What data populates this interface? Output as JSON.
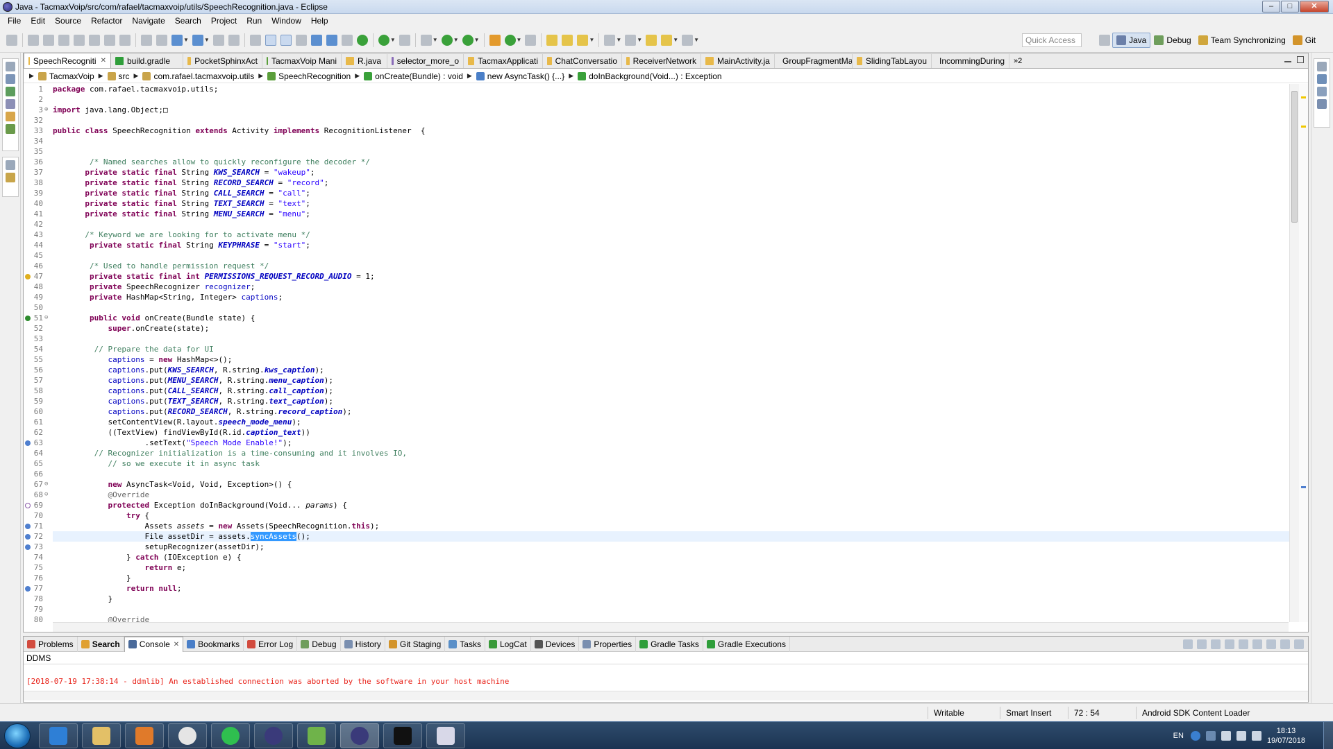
{
  "window": {
    "title": "Java - TacmaxVoip/src/com/rafael/tacmaxvoip/utils/SpeechRecognition.java - Eclipse"
  },
  "menu": [
    "File",
    "Edit",
    "Source",
    "Refactor",
    "Navigate",
    "Search",
    "Project",
    "Run",
    "Window",
    "Help"
  ],
  "toolbar": {
    "quick_access_placeholder": "Quick Access",
    "perspectives": [
      "Java",
      "Debug",
      "Team Synchronizing",
      "Git"
    ]
  },
  "editor_tabs": [
    {
      "label": "SpeechRecogniti",
      "active": true,
      "icon": "java-file-icon"
    },
    {
      "label": "build.gradle",
      "icon": "gradle-icon"
    },
    {
      "label": "PocketSphinxAct",
      "icon": "java-file-icon"
    },
    {
      "label": "TacmaxVoip Mani",
      "icon": "manifest-icon"
    },
    {
      "label": "R.java",
      "icon": "java-file-icon"
    },
    {
      "label": "selector_more_o",
      "icon": "xml-file-icon"
    },
    {
      "label": "TacmaxApplicati",
      "icon": "java-file-icon"
    },
    {
      "label": "ChatConversatio",
      "icon": "java-file-icon"
    },
    {
      "label": "ReceiverNetwork",
      "icon": "java-file-icon"
    },
    {
      "label": "MainActivity.ja",
      "icon": "java-file-icon"
    },
    {
      "label": "GroupFragmentMa",
      "icon": "java-file-icon"
    },
    {
      "label": "SlidingTabLayou",
      "icon": "java-file-icon"
    },
    {
      "label": "IncommingDuring",
      "icon": "java-file-icon"
    }
  ],
  "tab_overflow": "»2",
  "breadcrumb": [
    "TacmaxVoip",
    "src",
    "com.rafael.tacmaxvoip.utils",
    "SpeechRecognition",
    "onCreate(Bundle) : void",
    "new AsyncTask() {...}",
    "doInBackground(Void...) : Exception"
  ],
  "code_lines": [
    {
      "n": "1",
      "html": "<span class=\"kw\">package</span> com.rafael.tacmaxvoip.utils;"
    },
    {
      "n": "2",
      "html": ""
    },
    {
      "n": "3",
      "html": "<span class=\"kw\">import</span> java.lang.Object;&#9633;",
      "fold": "+"
    },
    {
      "n": "32",
      "html": ""
    },
    {
      "n": "33",
      "html": "<span class=\"kw\">public class</span> SpeechRecognition <span class=\"kw\">extends</span> Activity <span class=\"kw\">implements</span> RecognitionListener  {"
    },
    {
      "n": "34",
      "html": ""
    },
    {
      "n": "35",
      "html": ""
    },
    {
      "n": "36",
      "html": "        <span class=\"cm\">/* Named searches allow to quickly reconfigure the decoder */</span>"
    },
    {
      "n": "37",
      "html": "       <span class=\"kw\">private static final</span> String <span class=\"sf\">KWS_SEARCH</span> = <span class=\"st\">\"wakeup\"</span>;"
    },
    {
      "n": "38",
      "html": "       <span class=\"kw\">private static final</span> String <span class=\"sf\">RECORD_SEARCH</span> = <span class=\"st\">\"record\"</span>;"
    },
    {
      "n": "39",
      "html": "       <span class=\"kw\">private static final</span> String <span class=\"sf\">CALL_SEARCH</span> = <span class=\"st\">\"call\"</span>;"
    },
    {
      "n": "40",
      "html": "       <span class=\"kw\">private static final</span> String <span class=\"sf\">TEXT_SEARCH</span> = <span class=\"st\">\"text\"</span>;"
    },
    {
      "n": "41",
      "html": "       <span class=\"kw\">private static final</span> String <span class=\"sf\">MENU_SEARCH</span> = <span class=\"st\">\"menu\"</span>;"
    },
    {
      "n": "42",
      "html": ""
    },
    {
      "n": "43",
      "html": "       <span class=\"cm\">/* Keyword we are looking for to activate menu */</span>"
    },
    {
      "n": "44",
      "html": "        <span class=\"kw\">private static final</span> String <span class=\"sf\">KEYPHRASE</span> = <span class=\"st\">\"start\"</span>;"
    },
    {
      "n": "45",
      "html": ""
    },
    {
      "n": "46",
      "html": "        <span class=\"cm\">/* Used to handle permission request */</span>"
    },
    {
      "n": "47",
      "html": "        <span class=\"kw\">private static final int</span> <span class=\"sf\">PERMISSIONS_REQUEST_RECORD_AUDIO</span> = 1;",
      "marker": "warning"
    },
    {
      "n": "48",
      "html": "        <span class=\"kw\">private</span> SpeechRecognizer <span class=\"fi\">recognizer</span>;"
    },
    {
      "n": "49",
      "html": "        <span class=\"kw\">private</span> HashMap&lt;String, Integer&gt; <span class=\"fi\">captions</span>;"
    },
    {
      "n": "50",
      "html": ""
    },
    {
      "n": "51",
      "html": "        <span class=\"kw\">public void</span> onCreate(Bundle state) {",
      "fold": "-",
      "marker": "override"
    },
    {
      "n": "52",
      "html": "            <span class=\"kw\">super</span>.onCreate(state);"
    },
    {
      "n": "53",
      "html": ""
    },
    {
      "n": "54",
      "html": "         <span class=\"cm\">// Prepare the data for UI</span>"
    },
    {
      "n": "55",
      "html": "            <span class=\"fi\">captions</span> = <span class=\"kw\">new</span> HashMap&lt;&gt;();"
    },
    {
      "n": "56",
      "html": "            <span class=\"fi\">captions</span>.put(<span class=\"sf\">KWS_SEARCH</span>, R.string.<span class=\"sf\">kws_caption</span>);"
    },
    {
      "n": "57",
      "html": "            <span class=\"fi\">captions</span>.put(<span class=\"sf\">MENU_SEARCH</span>, R.string.<span class=\"sf\">menu_caption</span>);"
    },
    {
      "n": "58",
      "html": "            <span class=\"fi\">captions</span>.put(<span class=\"sf\">CALL_SEARCH</span>, R.string.<span class=\"sf\">call_caption</span>);"
    },
    {
      "n": "59",
      "html": "            <span class=\"fi\">captions</span>.put(<span class=\"sf\">TEXT_SEARCH</span>, R.string.<span class=\"sf\">text_caption</span>);"
    },
    {
      "n": "60",
      "html": "            <span class=\"fi\">captions</span>.put(<span class=\"sf\">RECORD_SEARCH</span>, R.string.<span class=\"sf\">record_caption</span>);"
    },
    {
      "n": "61",
      "html": "            setContentView(R.layout.<span class=\"sf\">speech_mode_menu</span>);"
    },
    {
      "n": "62",
      "html": "            ((TextView) findViewById(R.id.<span class=\"sf\">caption_text</span>))"
    },
    {
      "n": "63",
      "html": "                    .setText(<span class=\"st\">\"Speech Mode Enable!\"</span>);",
      "marker": "occurrence"
    },
    {
      "n": "64",
      "html": "         <span class=\"cm\">// Recognizer initialization is a time-consuming and it involves IO,</span>"
    },
    {
      "n": "65",
      "html": "            <span class=\"cm\">// so we execute it in async task</span>"
    },
    {
      "n": "66",
      "html": ""
    },
    {
      "n": "67",
      "html": "            <span class=\"kw\">new</span> AsyncTask&lt;Void, Void, Exception&gt;() {",
      "fold": "-"
    },
    {
      "n": "68",
      "html": "            <span class=\"an\">@Override</span>",
      "fold": "-"
    },
    {
      "n": "69",
      "html": "            <span class=\"kw\">protected</span> Exception doInBackground(Void... <span class=\"it\">params</span>) {",
      "marker": "override-hollow"
    },
    {
      "n": "70",
      "html": "                <span class=\"kw\">try</span> {"
    },
    {
      "n": "71",
      "html": "                    Assets <span class=\"it\">assets</span> = <span class=\"kw\">new</span> Assets(SpeechRecognition.<span class=\"kw\">this</span>);",
      "marker": "occurrence"
    },
    {
      "n": "72",
      "html": "                    File assetDir = assets.<span class=\"sel\">syncAssets</span>();",
      "current": true,
      "marker": "occurrence"
    },
    {
      "n": "73",
      "html": "                    setupRecognizer(assetDir);",
      "marker": "occurrence"
    },
    {
      "n": "74",
      "html": "                } <span class=\"kw\">catch</span> (IOException e) {"
    },
    {
      "n": "75",
      "html": "                    <span class=\"kw\">return</span> e;"
    },
    {
      "n": "76",
      "html": "                }"
    },
    {
      "n": "77",
      "html": "                <span class=\"kw\">return null</span>;",
      "marker": "occurrence"
    },
    {
      "n": "78",
      "html": "            }"
    },
    {
      "n": "79",
      "html": ""
    },
    {
      "n": "80",
      "html": "            <span class=\"an\">@Override</span>"
    }
  ],
  "panel": {
    "tabs": [
      {
        "label": "Problems",
        "icon": "problems-icon"
      },
      {
        "label": "Search",
        "icon": "search-icon",
        "bold": true
      },
      {
        "label": "Console",
        "icon": "console-icon",
        "active": true
      },
      {
        "label": "Bookmarks",
        "icon": "bookmark-icon"
      },
      {
        "label": "Error Log",
        "icon": "error-log-icon"
      },
      {
        "label": "Debug",
        "icon": "debug-icon"
      },
      {
        "label": "History",
        "icon": "history-icon"
      },
      {
        "label": "Git Staging",
        "icon": "git-staging-icon"
      },
      {
        "label": "Tasks",
        "icon": "tasks-icon"
      },
      {
        "label": "LogCat",
        "icon": "logcat-icon"
      },
      {
        "label": "Devices",
        "icon": "devices-icon"
      },
      {
        "label": "Properties",
        "icon": "properties-icon"
      },
      {
        "label": "Gradle Tasks",
        "icon": "gradle-icon"
      },
      {
        "label": "Gradle Executions",
        "icon": "gradle-icon"
      }
    ],
    "console_name": "DDMS",
    "console_output": "[2018-07-19 17:38:14 - ddmlib] An established connection was aborted by the software in your host machine"
  },
  "statusbar": {
    "mode": "Writable",
    "insert": "Smart Insert",
    "position": "72 : 54",
    "task": "Android SDK Content Loader"
  },
  "taskbar": {
    "apps": [
      "internet-explorer-icon",
      "file-explorer-icon",
      "media-player-icon",
      "chrome-icon",
      "whatsapp-icon",
      "eclipse-icon",
      "android-studio-icon",
      "eclipse-active-icon",
      "cmd-icon",
      "paint-icon"
    ],
    "lang": "EN",
    "time": "18:13",
    "date": "19/07/2018"
  },
  "colors": {
    "keyword": "#7f0055",
    "comment": "#3f7f5f",
    "string": "#2a00ff",
    "field": "#0000c0",
    "console_error": "#e8231a",
    "selection": "#3399ff"
  }
}
